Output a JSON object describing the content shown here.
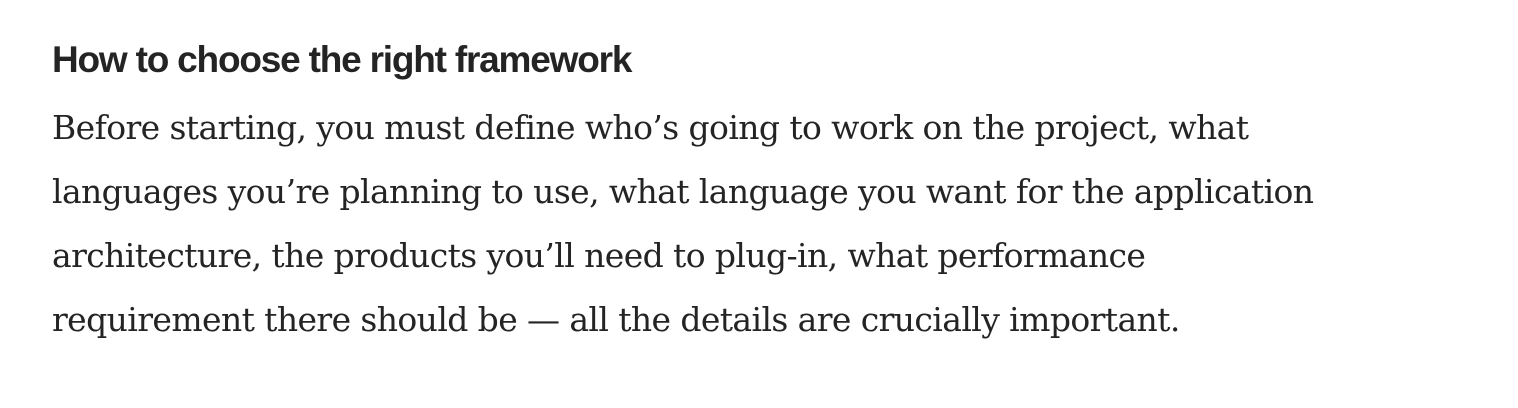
{
  "article": {
    "heading": "How to choose the right framework",
    "paragraph_lines": [
      "Before starting, you must define who’s going to work on the project, what",
      "languages you’re planning to use, what language you want for the application",
      "architecture, the products you’ll need to plug-in, what performance",
      "requirement there should be — all the details are crucially important."
    ]
  },
  "colors": {
    "text": "#242424",
    "background": "#ffffff"
  }
}
